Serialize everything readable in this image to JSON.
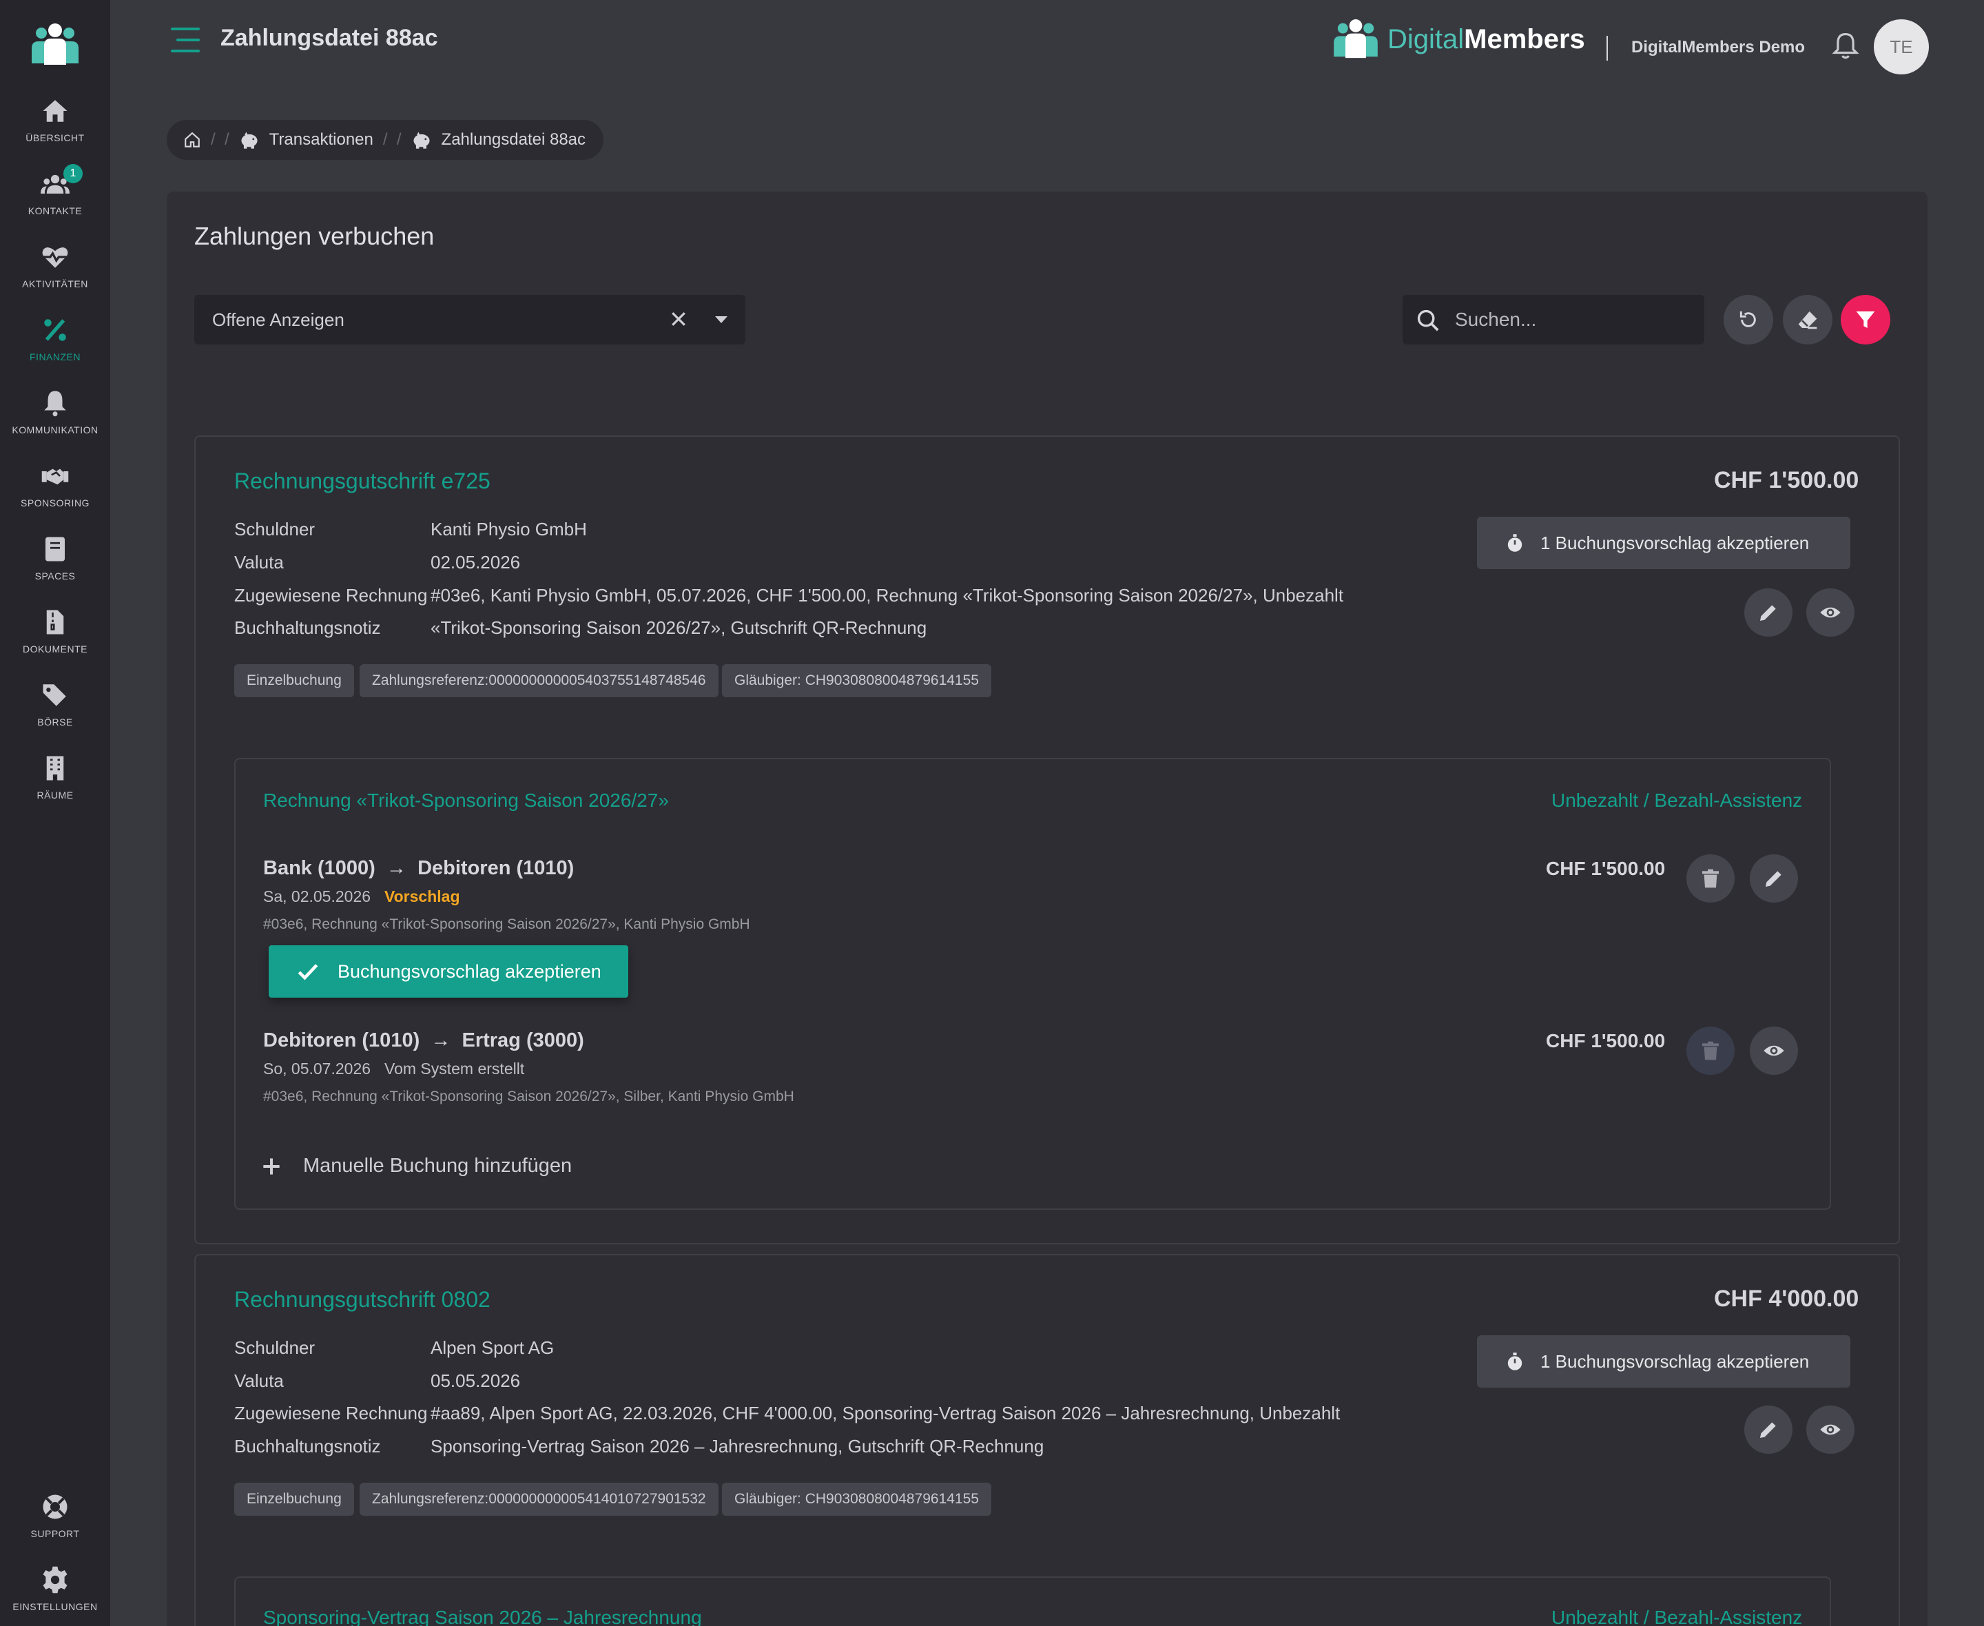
{
  "nav": {
    "items": [
      {
        "label": "Übersicht"
      },
      {
        "label": "Kontakte",
        "badge": "1"
      },
      {
        "label": "Aktivitäten"
      },
      {
        "label": "Finanzen"
      },
      {
        "label": "Kommunikation"
      },
      {
        "label": "Sponsoring"
      },
      {
        "label": "Spaces"
      },
      {
        "label": "Dokumente"
      },
      {
        "label": "Börse"
      },
      {
        "label": "Räume"
      }
    ],
    "bottom": [
      {
        "label": "Support"
      },
      {
        "label": "Einstellungen"
      }
    ],
    "active": "Finanzen"
  },
  "header": {
    "title": "Zahlungsdatei 88ac",
    "brand_part1": "Digital",
    "brand_part2": "Members",
    "org_name": "DigitalMembers Demo",
    "avatar_initials": "TE"
  },
  "breadcrumb": {
    "items": [
      {
        "label": "Transaktionen"
      },
      {
        "label": "Zahlungsdatei 88ac"
      }
    ]
  },
  "panel": {
    "title": "Zahlungen verbuchen",
    "filter_value": "Offene Anzeigen",
    "search_placeholder": "Suchen..."
  },
  "labels": {
    "debtor": "Schuldner",
    "valuta": "Valuta",
    "assigned_invoice": "Zugewiesene Rechnung",
    "accounting_note": "Buchhaltungsnotiz",
    "add_booking": "Manuelle Buchung hinzufügen",
    "accept_suggestion": "Buchungsvorschlag akzeptieren"
  },
  "cards": [
    {
      "title": "Rechnungsgutschrift e725",
      "amount": "CHF 1'500.00",
      "debtor": "Kanti Physio GmbH",
      "valuta": "02.05.2026",
      "assigned_invoice": "#03e6, Kanti Physio GmbH, 05.07.2026, CHF 1'500.00, Rechnung «Trikot-Sponsoring Saison 2026/27», Unbezahlt",
      "accounting_note": "«Trikot-Sponsoring Saison 2026/27», Gutschrift QR-Rechnung",
      "accept_all_label": "1 Buchungsvorschlag akzeptieren",
      "tags": [
        "Einzelbuchung",
        "Zahlungsreferenz:000000000005403755148748546",
        "Gläubiger: CH9030808004879614155"
      ],
      "invoice": {
        "title": "Rechnung «Trikot-Sponsoring Saison 2026/27»",
        "status": "Unbezahlt / Bezahl-Assistenz",
        "bookings": [
          {
            "from": "Bank (1000)",
            "to": "Debitoren (1010)",
            "amount": "CHF 1'500.00",
            "date": "Sa, 02.05.2026",
            "flag": "Vorschlag",
            "description": "#03e6, Rechnung «Trikot-Sponsoring Saison 2026/27», Kanti Physio GmbH"
          },
          {
            "from": "Debitoren (1010)",
            "to": "Ertrag (3000)",
            "amount": "CHF 1'500.00",
            "date": "So, 05.07.2026",
            "source": "Vom System erstellt",
            "description": "#03e6, Rechnung «Trikot-Sponsoring Saison 2026/27», Silber, Kanti Physio GmbH"
          }
        ]
      }
    },
    {
      "title": "Rechnungsgutschrift 0802",
      "amount": "CHF 4'000.00",
      "debtor": "Alpen Sport AG",
      "valuta": "05.05.2026",
      "assigned_invoice": "#aa89, Alpen Sport AG, 22.03.2026, CHF 4'000.00, Sponsoring-Vertrag Saison 2026 – Jahresrechnung, Unbezahlt",
      "accounting_note": "Sponsoring-Vertrag Saison 2026 – Jahresrechnung, Gutschrift QR-Rechnung",
      "accept_all_label": "1 Buchungsvorschlag akzeptieren",
      "tags": [
        "Einzelbuchung",
        "Zahlungsreferenz:000000000005414010727901532",
        "Gläubiger: CH9030808004879614155"
      ],
      "invoice": {
        "title": "Sponsoring-Vertrag Saison 2026 – Jahresrechnung",
        "status": "Unbezahlt / Bezahl-Assistenz"
      }
    }
  ],
  "colors": {
    "accent": "#14a08c",
    "warning": "#f5a623",
    "filter_button": "#ec1e5b"
  }
}
